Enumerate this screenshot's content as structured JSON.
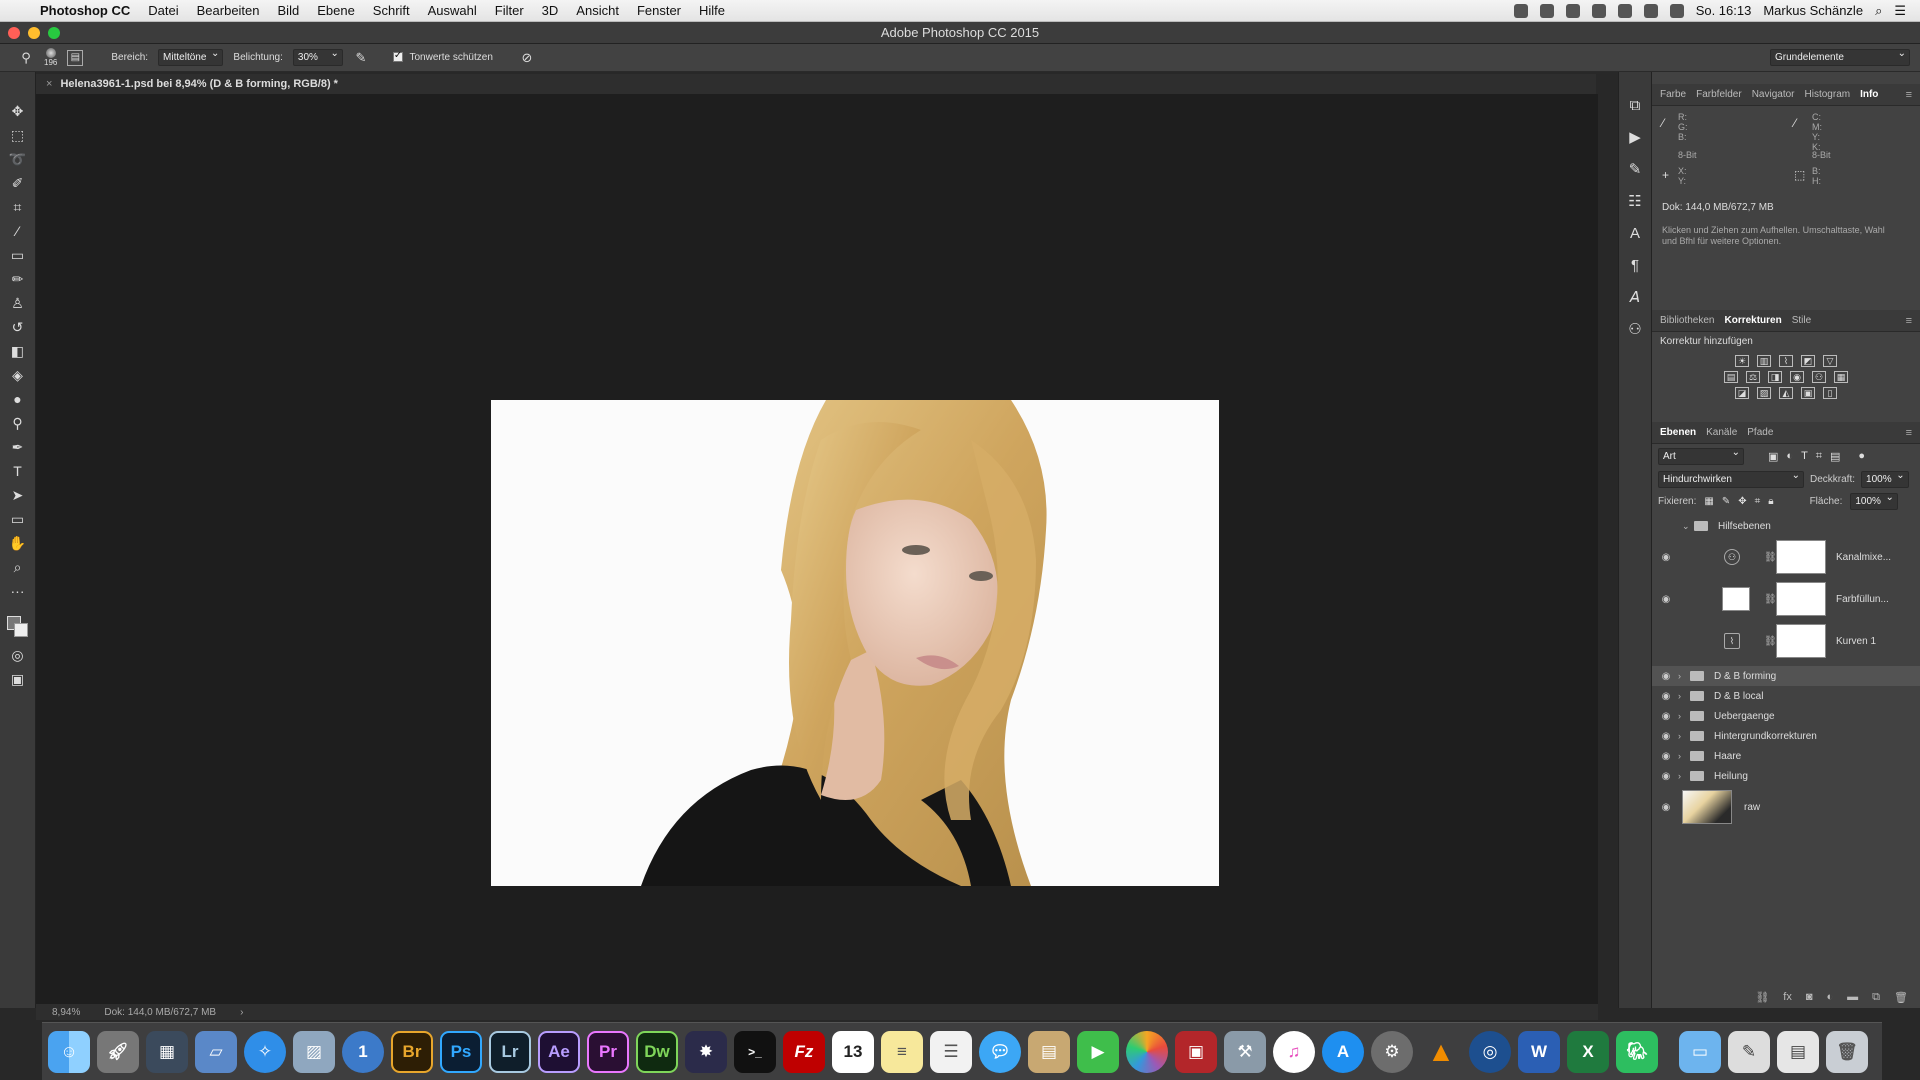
{
  "menubar": {
    "app_name": "Photoshop CC",
    "items": [
      "Datei",
      "Bearbeiten",
      "Bild",
      "Ebene",
      "Schrift",
      "Auswahl",
      "Filter",
      "3D",
      "Ansicht",
      "Fenster",
      "Hilfe"
    ],
    "clock": "So. 16:13",
    "user": "Markus Schänzle"
  },
  "window": {
    "title": "Adobe Photoshop CC 2015"
  },
  "options": {
    "brush_size": "196",
    "range_label": "Bereich:",
    "range_value": "Mitteltöne",
    "exposure_label": "Belichtung:",
    "exposure_value": "30%",
    "protect_tones_label": "Tonwerte schützen",
    "workspace": "Grundelemente"
  },
  "document": {
    "tab_title": "Helena3961-1.psd bei 8,94% (D & B forming, RGB/8) *",
    "zoom": "8,94%",
    "doc_size": "Dok: 144,0 MB/672,7 MB"
  },
  "info_panel": {
    "tabs": [
      "Farbe",
      "Farbfelder",
      "Navigator",
      "Histogram",
      "Info"
    ],
    "active_tab": "Info",
    "rgb": "R:\nG:\nB:",
    "cmyk": "C:\nM:\nY:\nK:",
    "bit_left": "8-Bit",
    "bit_right": "8-Bit",
    "xy": "X:\nY:",
    "bh": "B:\nH:",
    "doc": "Dok: 144,0 MB/672,7 MB",
    "hint": "Klicken und Ziehen zum Aufhellen. Umschalttaste, Wahl und Bfhl für weitere Optionen."
  },
  "corrections_panel": {
    "tabs": [
      "Bibliotheken",
      "Korrekturen",
      "Stile"
    ],
    "active_tab": "Korrekturen",
    "title": "Korrektur hinzufügen"
  },
  "layers_panel": {
    "tabs": [
      "Ebenen",
      "Kanäle",
      "Pfade"
    ],
    "active_tab": "Ebenen",
    "filter": "Art",
    "blend_mode": "Hindurchwirken",
    "opacity_label": "Deckkraft:",
    "opacity": "100%",
    "lock_label": "Fixieren:",
    "fill_label": "Fläche:",
    "fill": "100%",
    "layers": [
      {
        "name": "Hilfsebenen",
        "kind": "group-open"
      },
      {
        "name": "Kanalmixe...",
        "kind": "adjustment"
      },
      {
        "name": "Farbfüllun...",
        "kind": "fill"
      },
      {
        "name": "Kurven 1",
        "kind": "curves"
      },
      {
        "name": "D & B forming",
        "kind": "group",
        "selected": true
      },
      {
        "name": "D & B local",
        "kind": "group"
      },
      {
        "name": "Uebergaenge",
        "kind": "group"
      },
      {
        "name": "Hintergrundkorrekturen",
        "kind": "group"
      },
      {
        "name": "Haare",
        "kind": "group"
      },
      {
        "name": "Heilung",
        "kind": "group"
      },
      {
        "name": "raw",
        "kind": "smart"
      }
    ]
  },
  "dock": {
    "apps": [
      "Finder",
      "Launchpad",
      "Mission Control",
      "Migration",
      "Safari",
      "Preview",
      "1Password",
      "Br",
      "Ps",
      "Lr",
      "Ae",
      "Pr",
      "Dw",
      "Motion",
      "Terminal",
      "FileZilla",
      "Calendar",
      "Notes",
      "TextEdit",
      "Messages",
      "Contacts",
      "FaceTime",
      "Photos",
      "Photo Booth",
      "Utility",
      "iTunes",
      "App Store",
      "System Preferences",
      "VLC",
      "Camera",
      "Word",
      "Excel",
      "Evernote",
      "Folder",
      "Brushes",
      "Desktop",
      "Trash"
    ],
    "calendar_date": "13"
  },
  "colors": {
    "accent_close": "#ff5f57",
    "accent_min": "#ffbd2e",
    "accent_max": "#28c940",
    "canvas_bg": "#1e1e1e",
    "panel_bg": "#424242"
  }
}
